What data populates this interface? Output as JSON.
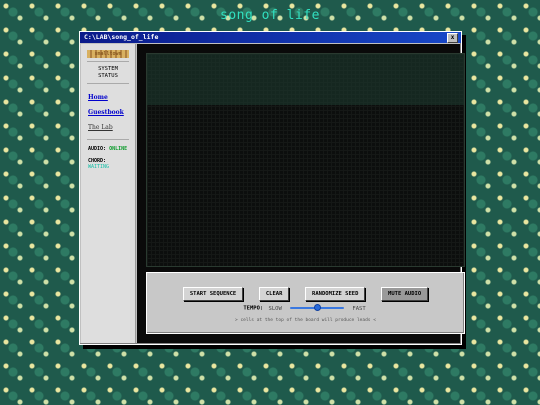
{
  "page": {
    "title": "song of life"
  },
  "window": {
    "title": "C:\\LAB\\song_of_life",
    "close_label": "x"
  },
  "sidebar": {
    "logo_text": "smalltown",
    "status_heading_line1": "SYSTEM",
    "status_heading_line2": "STATUS",
    "nav": [
      {
        "label": "Home"
      },
      {
        "label": "Guestbook"
      },
      {
        "label": "The Lab"
      }
    ],
    "audio_label": "AUDIO:",
    "audio_value": "ONLINE",
    "chord_label": "CHORD:",
    "chord_value": "WAITING"
  },
  "controls": {
    "buttons": [
      {
        "label": "START SEQUENCE",
        "active": false
      },
      {
        "label": "CLEAR",
        "active": false
      },
      {
        "label": "RANDOMIZE SEED",
        "active": false
      },
      {
        "label": "MUTE AUDIO",
        "active": true
      }
    ],
    "tempo_label": "TEMPO:",
    "slow_label": "SLOW",
    "fast_label": "FAST",
    "tempo_value": 0.5,
    "hint": "> cells at the top of the board will produce leads <"
  },
  "colors": {
    "title": "#31e0c0",
    "titlebar": "#0a1a8a",
    "audio_online": "#0a9a2a",
    "chord_waiting": "#18c0a8",
    "slider": "#3a78e0"
  }
}
